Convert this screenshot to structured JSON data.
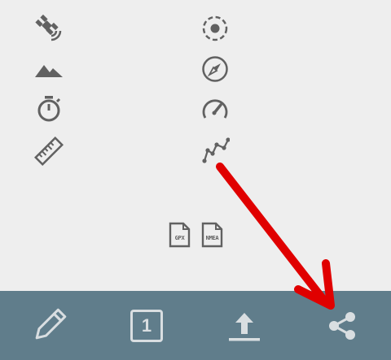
{
  "stats": {
    "left_column": [
      {
        "icon": "satellite-icon"
      },
      {
        "icon": "mountain-icon"
      },
      {
        "icon": "stopwatch-icon"
      },
      {
        "icon": "ruler-icon"
      }
    ],
    "right_column": [
      {
        "icon": "gps-fix-icon"
      },
      {
        "icon": "compass-icon"
      },
      {
        "icon": "speedometer-icon"
      },
      {
        "icon": "track-chart-icon"
      }
    ]
  },
  "export": {
    "gpx_label": "GPX",
    "nmea_label": "NMEA"
  },
  "toolbar": {
    "edit_icon": "pencil-icon",
    "track_count": "1",
    "upload_icon": "upload-icon",
    "share_icon": "share-icon"
  },
  "colors": {
    "background": "#eeeeee",
    "icon": "#616161",
    "toolbar": "#607d8b",
    "toolbar_icon": "#d9dee1",
    "annotation_arrow": "#e00000"
  }
}
